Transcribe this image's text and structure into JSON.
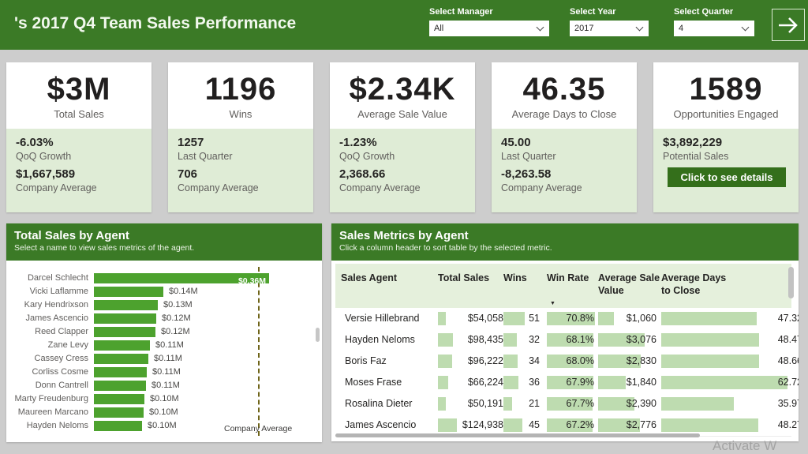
{
  "colors": {
    "theme-green": "#3b7a26",
    "bar-green": "#4da22e",
    "light-green": "#dfecd6",
    "table-bar-green": "#bedcb0",
    "table-header-bg": "#e5f0dc",
    "button-green": "#346f1b",
    "ref-line": "#6f6419",
    "page-bg": "#cdcdcd"
  },
  "header": {
    "title": "'s 2017 Q4 Team Sales Performance",
    "filters": [
      {
        "label": "Select Manager",
        "value": "All"
      },
      {
        "label": "Select Year",
        "value": "2017"
      },
      {
        "label": "Select Quarter",
        "value": "4"
      }
    ],
    "nav_icon": "arrow-right-icon"
  },
  "kpi_cards": [
    {
      "value": "$3M",
      "label": "Total Sales",
      "details": [
        {
          "value": "-6.03%",
          "label": "QoQ Growth"
        },
        {
          "value": "$1,667,589",
          "label": "Company Average"
        }
      ]
    },
    {
      "value": "1196",
      "label": "Wins",
      "details": [
        {
          "value": "1257",
          "label": "Last Quarter"
        },
        {
          "value": "706",
          "label": "Company Average"
        }
      ]
    },
    {
      "value": "$2.34K",
      "label": "Average Sale Value",
      "details": [
        {
          "value": "-1.23%",
          "label": "QoQ Growth"
        },
        {
          "value": "2,368.66",
          "label": "Company Average"
        }
      ]
    },
    {
      "value": "46.35",
      "label": "Average Days to Close",
      "details": [
        {
          "value": "45.00",
          "label": "Last Quarter"
        },
        {
          "value": "-8,263.58",
          "label": "Company Average"
        }
      ]
    },
    {
      "value": "1589",
      "label": "Opportunities Engaged",
      "details": [
        {
          "value": "$3,892,229",
          "label": "Potential Sales"
        }
      ],
      "button": "Click to see details"
    }
  ],
  "chart_data": [
    {
      "type": "bar",
      "orientation": "horizontal",
      "title": "Total Sales by Agent",
      "subtitle": "Select a name to view sales metrics of the agent.",
      "categories": [
        "Darcel Schlecht",
        "Vicki Laflamme",
        "Kary Hendrixson",
        "James Ascencio",
        "Reed Clapper",
        "Zane Levy",
        "Cassey Cress",
        "Corliss Cosme",
        "Donn Cantrell",
        "Marty Freudenburg",
        "Maureen Marcano",
        "Hayden Neloms"
      ],
      "values": [
        0.36,
        0.142,
        0.131,
        0.128,
        0.126,
        0.115,
        0.112,
        0.109,
        0.107,
        0.103,
        0.102,
        0.099
      ],
      "data_labels": [
        "$0.36M",
        "$0.14M",
        "$0.13M",
        "$0.12M",
        "$0.12M",
        "$0.11M",
        "$0.11M",
        "$0.11M",
        "$0.11M",
        "$0.10M",
        "$0.10M",
        "$0.10M"
      ],
      "xlim": [
        0,
        0.36
      ],
      "units": "$M",
      "grid": false,
      "reference_line": {
        "label": "Company Average",
        "value": 0.337
      }
    },
    {
      "type": "table",
      "title": "Sales Metrics by Agent",
      "subtitle": "Click a column header to sort table by the selected metric.",
      "columns": [
        "Sales Agent",
        "Total Sales",
        "Wins",
        "Win Rate",
        "Average Sale Value",
        "Average Days to Close"
      ],
      "sorted_column": "Win Rate",
      "sort_direction": "descending",
      "sort_glyph": "▼",
      "rows": [
        {
          "agent": "Versie Hillebrand",
          "cells": [
            {
              "text": "$54,058",
              "num": 54058
            },
            {
              "text": "51",
              "num": 51
            },
            {
              "text": "70.8%",
              "num": 70.8
            },
            {
              "text": "$1,060",
              "num": 1060
            },
            {
              "text": "47.32",
              "num": 47.32
            }
          ]
        },
        {
          "agent": "Hayden Neloms",
          "cells": [
            {
              "text": "$98,435",
              "num": 98435
            },
            {
              "text": "32",
              "num": 32
            },
            {
              "text": "68.1%",
              "num": 68.1
            },
            {
              "text": "$3,076",
              "num": 3076
            },
            {
              "text": "48.47",
              "num": 48.47
            }
          ]
        },
        {
          "agent": "Boris Faz",
          "cells": [
            {
              "text": "$96,222",
              "num": 96222
            },
            {
              "text": "34",
              "num": 34
            },
            {
              "text": "68.0%",
              "num": 68.0
            },
            {
              "text": "$2,830",
              "num": 2830
            },
            {
              "text": "48.66",
              "num": 48.66
            }
          ]
        },
        {
          "agent": "Moses Frase",
          "cells": [
            {
              "text": "$66,224",
              "num": 66224
            },
            {
              "text": "36",
              "num": 36
            },
            {
              "text": "67.9%",
              "num": 67.9
            },
            {
              "text": "$1,840",
              "num": 1840
            },
            {
              "text": "62.72",
              "num": 62.72
            }
          ]
        },
        {
          "agent": "Rosalina Dieter",
          "cells": [
            {
              "text": "$50,191",
              "num": 50191
            },
            {
              "text": "21",
              "num": 21
            },
            {
              "text": "67.7%",
              "num": 67.7
            },
            {
              "text": "$2,390",
              "num": 2390
            },
            {
              "text": "35.97",
              "num": 35.97
            }
          ]
        },
        {
          "agent": "James Ascencio",
          "cells": [
            {
              "text": "$124,938",
              "num": 124938
            },
            {
              "text": "45",
              "num": 45
            },
            {
              "text": "67.2%",
              "num": 67.2
            },
            {
              "text": "$2,776",
              "num": 2776
            },
            {
              "text": "48.27",
              "num": 48.27
            }
          ]
        }
      ]
    }
  ],
  "watermark": "Activate W"
}
